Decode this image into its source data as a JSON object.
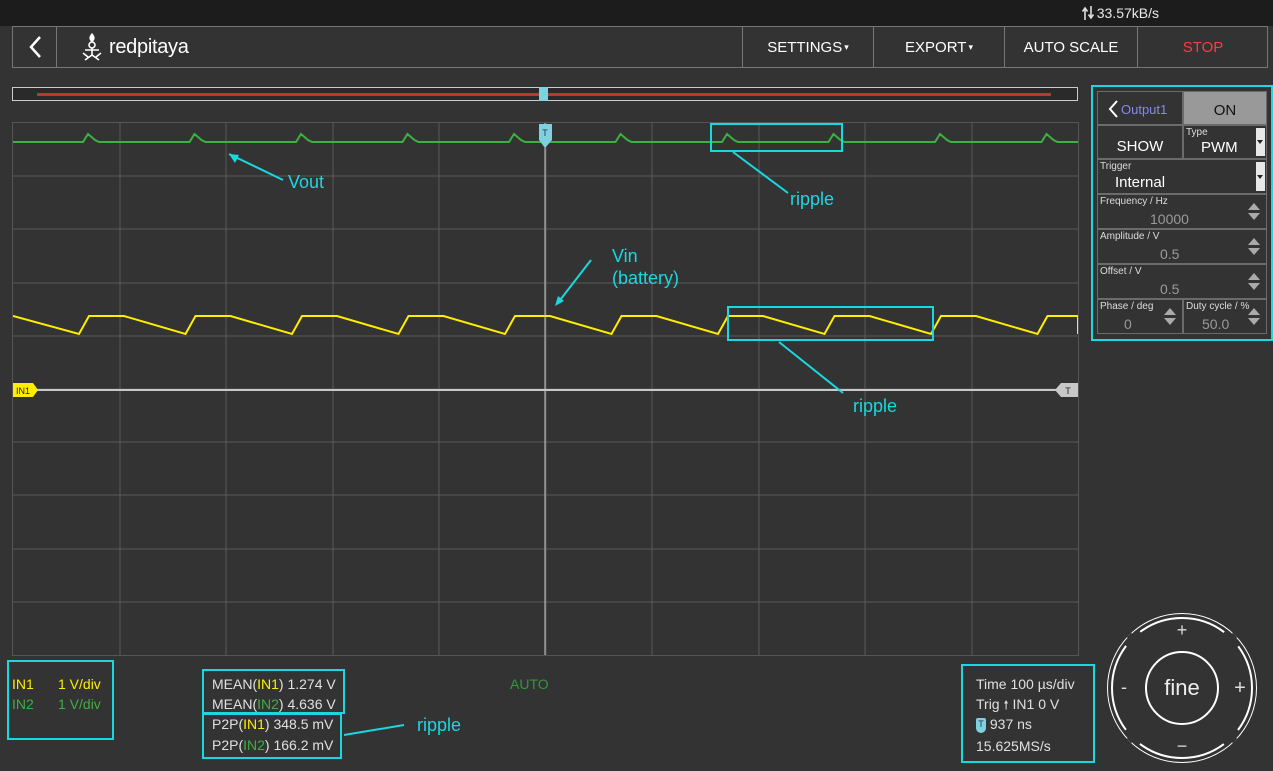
{
  "status_bar": {
    "net_rate": "33.57kB/s",
    "icon": "updown-arrows-icon"
  },
  "header": {
    "back_icon": "chevron-left-icon",
    "logo_text": "redpitaya",
    "settings_label": "SETTINGS",
    "export_label": "EXPORT",
    "autoscale_label": "AUTO SCALE",
    "stop_label": "STOP"
  },
  "plot": {
    "trigger_marker": "T",
    "ch1_marker": "IN1",
    "trigger_level_marker": "T",
    "colors": {
      "in1": "#ffee00",
      "in2": "#3cb043",
      "grid": "#5a5a5a",
      "accent": "#19d8e0",
      "stop": "#ff3c3c"
    }
  },
  "generator": {
    "title": "Output1",
    "on_label": "ON",
    "show_label": "SHOW",
    "type_label": "Type",
    "type_value": "PWM",
    "trigger_label": "Trigger",
    "trigger_value": "Internal",
    "frequency_label": "Frequency / Hz",
    "frequency_value": "10000",
    "amplitude_label": "Amplitude / V",
    "amplitude_value": "0.5",
    "offset_label": "Offset / V",
    "offset_value": "0.5",
    "phase_label": "Phase / deg",
    "phase_value": "0",
    "duty_label": "Duty cycle / %",
    "duty_value": "50.0"
  },
  "channels": {
    "in1_label": "IN1",
    "in1_scale": "1 V/div",
    "in2_label": "IN2",
    "in2_scale": "1 V/div"
  },
  "measurements": {
    "mean1_prefix": "MEAN(",
    "mean1_ch": "IN1",
    "mean1_value": ") 1.274 V",
    "mean2_prefix": "MEAN(",
    "mean2_ch": "IN2",
    "mean2_value": ") 4.636 V",
    "p2p1_prefix": "P2P(",
    "p2p1_ch": "IN1",
    "p2p1_value": ") 348.5 mV",
    "p2p2_prefix": "P2P(",
    "p2p2_ch": "IN2",
    "p2p2_value": ") 166.2 mV"
  },
  "trigger_mode": "AUTO",
  "timebase": {
    "time": "Time 100 µs/div",
    "trig": "IN1 0 V",
    "trig_prefix": "Trig",
    "delay": "937 ns",
    "rate": "15.625MS/s"
  },
  "annotations": {
    "vout": "Vout",
    "vin_1": "Vin",
    "vin_2": "(battery)",
    "ripple_top": "ripple",
    "ripple_mid": "ripple",
    "ripple_bottom": "ripple"
  },
  "jog": {
    "plus_top": "+",
    "minus_bottom": "−",
    "minus_left": "-",
    "plus_right": "+",
    "center": "fine"
  }
}
